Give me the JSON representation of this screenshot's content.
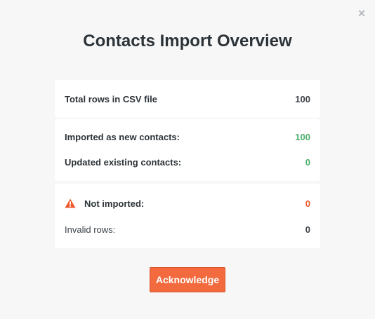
{
  "modal": {
    "title": "Contacts Import Overview",
    "close_icon": "close-icon"
  },
  "summary": {
    "total_label": "Total rows in CSV file",
    "total_value": "100"
  },
  "imported": {
    "new_label": "Imported as new contacts:",
    "new_value": "100",
    "updated_label": "Updated existing contacts:",
    "updated_value": "0"
  },
  "failed": {
    "icon": "warning-icon",
    "not_imported_label": "Not imported:",
    "not_imported_value": "0",
    "invalid_label": "Invalid rows:",
    "invalid_value": "0"
  },
  "actions": {
    "acknowledge_label": "Acknowledge"
  },
  "colors": {
    "accent": "#f26a3d",
    "success": "#4caf6a",
    "error": "#ee5a2b",
    "background": "#f7f7f7"
  }
}
